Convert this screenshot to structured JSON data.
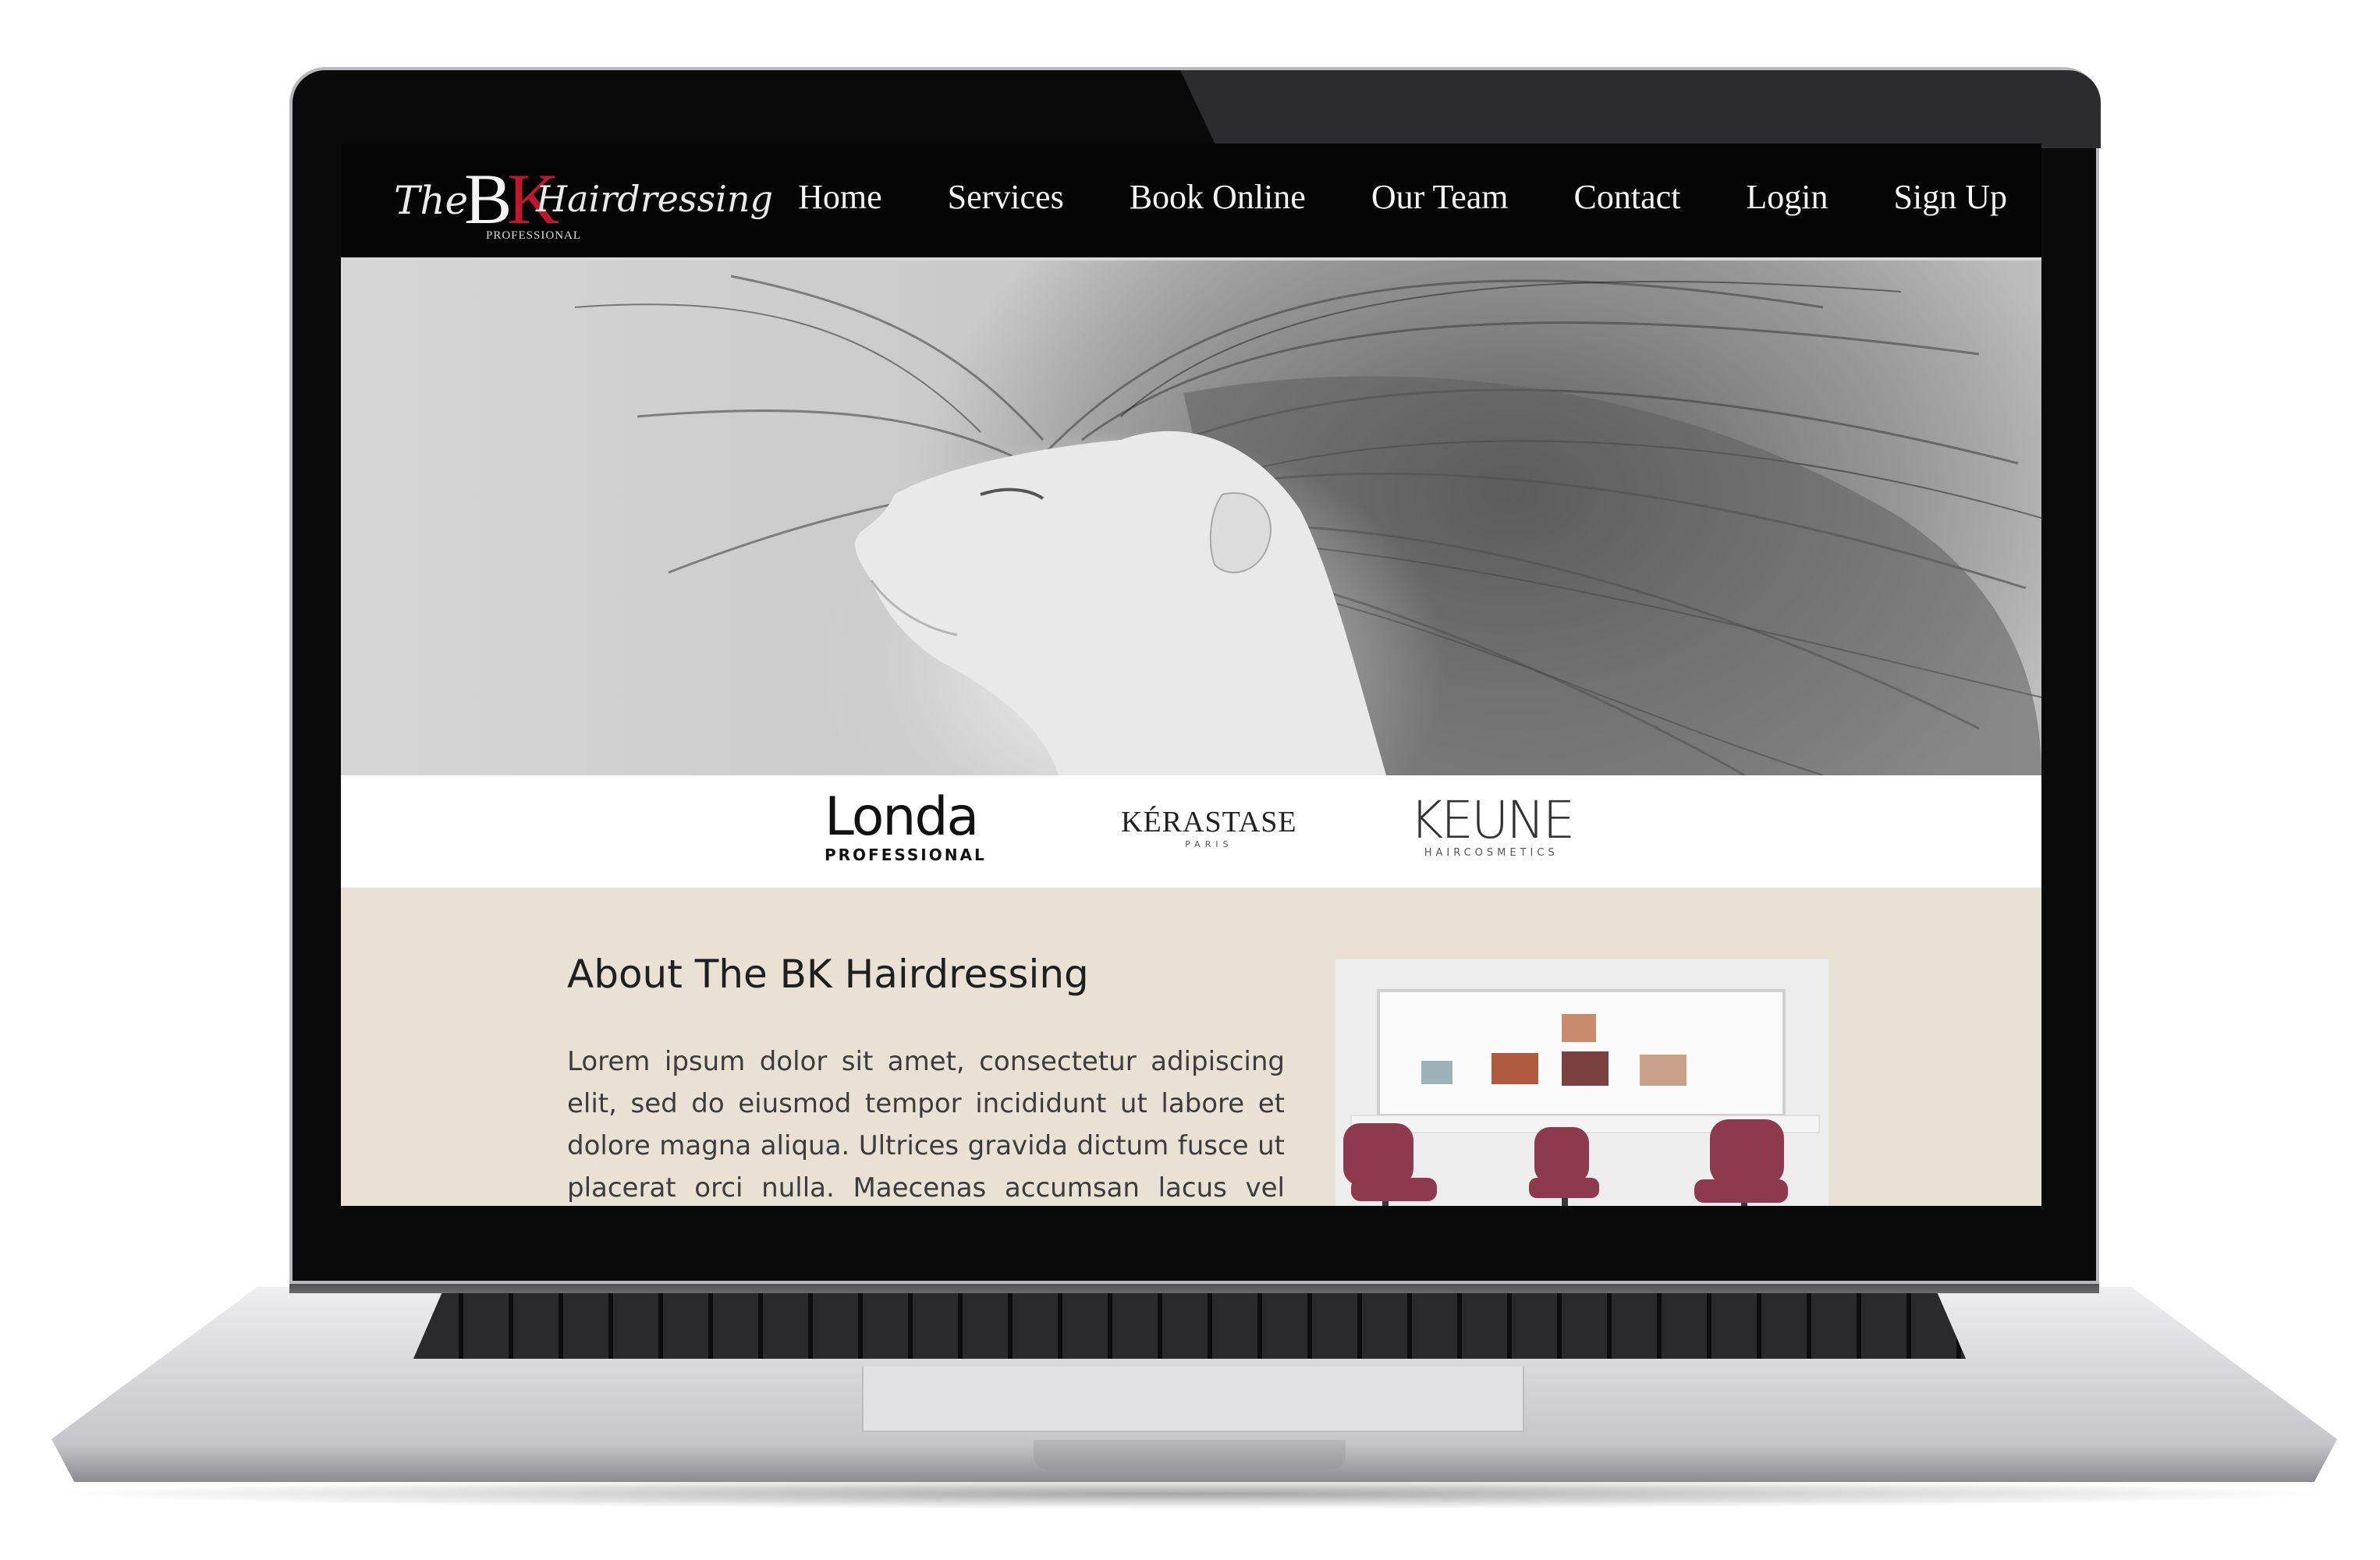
{
  "logo": {
    "the": "The",
    "bk_b": "B",
    "bk_k": "K",
    "hairdressing": "Hairdressing",
    "professional": "PROFESSIONAL"
  },
  "nav": {
    "items": [
      {
        "label": "Home"
      },
      {
        "label": "Services"
      },
      {
        "label": "Book Online"
      },
      {
        "label": "Our Team"
      },
      {
        "label": "Contact"
      },
      {
        "label": "Login"
      },
      {
        "label": "Sign Up"
      }
    ]
  },
  "brands": {
    "londa": {
      "word": "Londa",
      "sub": "PROFESSIONAL"
    },
    "kerastase": {
      "word": "KÉRASTASE",
      "sub": "PARIS"
    },
    "keune": {
      "word": "KEUNE",
      "sub": "HAIRCOSMETICS"
    }
  },
  "about": {
    "title": "About The BK Hairdressing",
    "body": "Lorem ipsum dolor sit amet, consectetur adipiscing elit, sed do eiusmod tempor incididunt ut labore et dolore magna aliqua. Ultrices gravida dictum fusce ut placerat orci nulla. Maecenas accumsan lacus vel facilisis. Turpis"
  },
  "colors": {
    "nav_bg": "#050505",
    "about_bg": "#e8e1d4",
    "logo_accent": "#c0182a",
    "chair": "#8e3a4e"
  }
}
